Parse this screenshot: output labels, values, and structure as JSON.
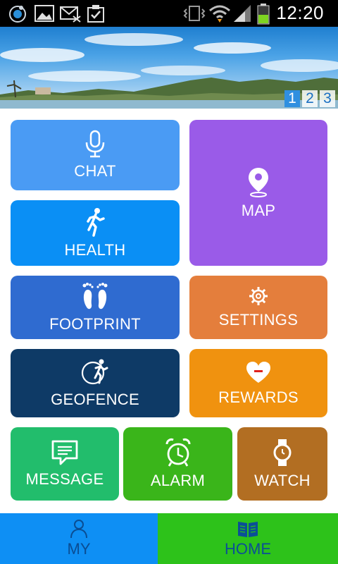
{
  "status_bar": {
    "time": "12:20",
    "icons": [
      "app-icon",
      "gallery-icon",
      "missed-mail-icon",
      "clipboard-check-icon",
      "vibrate-icon",
      "wifi-icon",
      "signal-icon",
      "battery-icon"
    ]
  },
  "banner": {
    "pages": [
      "1",
      "2",
      "3"
    ],
    "active_page": "1"
  },
  "tiles": {
    "chat": {
      "label": "CHAT",
      "icon": "microphone-icon",
      "color": "#4a9bf4"
    },
    "map": {
      "label": "MAP",
      "icon": "location-pin-icon",
      "color": "#9a5be8"
    },
    "health": {
      "label": "HEALTH",
      "icon": "running-person-icon",
      "color": "#0a8ff5"
    },
    "footprint": {
      "label": "FOOTPRINT",
      "icon": "footprints-icon",
      "color": "#2f6bd0"
    },
    "settings": {
      "label": "SETTINGS",
      "icon": "gear-icon",
      "color": "#e47e3c"
    },
    "geofence": {
      "label": "GEOFENCE",
      "icon": "geofence-runner-icon",
      "color": "#0e3a66"
    },
    "rewards": {
      "label": "REWARDS",
      "icon": "heart-icon",
      "color": "#f0920f"
    },
    "message": {
      "label": "MESSAGE",
      "icon": "chat-bubble-icon",
      "color": "#22bd6c"
    },
    "alarm": {
      "label": "ALARM",
      "icon": "alarm-clock-icon",
      "color": "#3ab51a"
    },
    "watch": {
      "label": "WATCH",
      "icon": "watch-icon",
      "color": "#b26e22"
    }
  },
  "bottom_nav": {
    "my": {
      "label": "MY",
      "icon": "person-icon"
    },
    "home": {
      "label": "HOME",
      "icon": "open-book-icon",
      "active": true
    }
  }
}
